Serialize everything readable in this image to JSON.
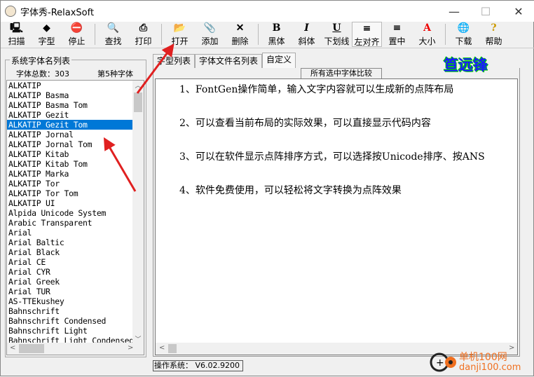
{
  "window": {
    "title": "字体秀-RelaxSoft",
    "minimize": "—",
    "maximize": "☐",
    "close": "✕"
  },
  "toolbar": [
    {
      "label": "扫描",
      "icon": "computer-icon",
      "glyph": "🖳"
    },
    {
      "label": "字型",
      "icon": "shapes-icon",
      "glyph": "◆"
    },
    {
      "label": "停止",
      "icon": "stop-icon",
      "glyph": "⛔"
    },
    {
      "sep": true
    },
    {
      "label": "查找",
      "icon": "find-icon",
      "glyph": "🔍"
    },
    {
      "label": "打印",
      "icon": "printer-icon",
      "glyph": "⎙"
    },
    {
      "sep": true
    },
    {
      "label": "打开",
      "icon": "open-folder-icon",
      "glyph": "📂"
    },
    {
      "label": "添加",
      "icon": "paperclip-icon",
      "glyph": "📎"
    },
    {
      "label": "删除",
      "icon": "delete-x-icon",
      "glyph": "✕"
    },
    {
      "sep": true
    },
    {
      "label": "黑体",
      "icon": "bold-icon",
      "glyph": "B"
    },
    {
      "label": "斜体",
      "icon": "italic-icon",
      "glyph": "I"
    },
    {
      "label": "下划线",
      "icon": "underline-icon",
      "glyph": "U"
    },
    {
      "label": "左对齐",
      "icon": "align-left-icon",
      "glyph": "≡",
      "pressed": true
    },
    {
      "label": "置中",
      "icon": "align-center-icon",
      "glyph": "≡"
    },
    {
      "label": "大小",
      "icon": "font-size-icon",
      "glyph": "A"
    },
    {
      "sep": true
    },
    {
      "label": "下载",
      "icon": "download-icon",
      "glyph": "🌐"
    },
    {
      "label": "帮助",
      "icon": "help-icon",
      "glyph": "?"
    }
  ],
  "left": {
    "group_title": "系统字体名列表",
    "count": "字体总数：303",
    "nth": "第5种字体",
    "fonts": [
      "ALKATIP",
      "ALKATIP Basma",
      "ALKATIP Basma Tom",
      "ALKATIP Gezit",
      "ALKATIP Gezit Tom",
      "ALKATIP Jornal",
      "ALKATIP Jornal Tom",
      "ALKATIP Kitab",
      "ALKATIP Kitab Tom",
      "ALKATIP Marka",
      "ALKATIP Tor",
      "ALKATIP Tor Tom",
      "ALKATIP UI",
      "Alpida Unicode System",
      "Arabic Transparent",
      "Arial",
      "Arial Baltic",
      "Arial Black",
      "Arial CE",
      "Arial CYR",
      "Arial Greek",
      "Arial TUR",
      "AS-TTEkushey",
      "Bahnschrift",
      "Bahnschrift Condensed",
      "Bahnschrift Light",
      "Bahnschrift Light Condensed"
    ],
    "selected_index": 4
  },
  "tabs": [
    {
      "label": "字型列表"
    },
    {
      "label": "字体文件名列表"
    },
    {
      "label": "自定义",
      "active": true
    }
  ],
  "compare_button": "所有选中字体比较",
  "logo_text": "笪远锋",
  "content": {
    "lines": [
      "1、FontGen操作简单，输入文字内容就可以生成新的点阵布局",
      "2、可以查看当前布局的实际效果，可以直接显示代码内容",
      "3、可以在软件显示点阵排序方式，可以选择按Unicode排序、按ANS",
      "4、软件免费使用，可以轻松将文字转换为点阵效果"
    ]
  },
  "status": "操作系统： V6.02.9200",
  "watermark": {
    "line1": "单机100网",
    "line2": "danji100.com"
  }
}
